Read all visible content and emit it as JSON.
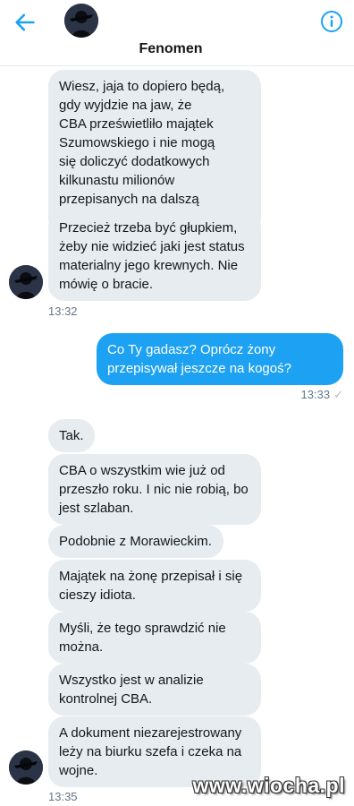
{
  "header": {
    "title": "Fenomen",
    "back_icon": "arrow-left-icon",
    "info_icon": "info-circle-icon"
  },
  "colors": {
    "incoming_bubble": "#e6ecf0",
    "outgoing_bubble": "#1da1f2",
    "accent": "#1da1f2"
  },
  "messages": [
    {
      "from": "them",
      "text": "Wiesz, jaja to dopiero będą,\ngdy wyjdzie na jaw, że\nCBA prześwietliło majątek\nSzumowskiego i nie mogą\nsię doliczyć dodatkowych\nkilkunastu milionów\nprzepisanych na dalszą rodzinę."
    },
    {
      "from": "them",
      "text": "Przecież trzeba być głupkiem,\nżeby nie widzieć jaki jest status\nmaterialny jego krewnych. Nie\nmówię o bracie."
    },
    {
      "from": "me",
      "text": "Co Ty gadasz? Oprócz żony\nprzepisywał jeszcze na kogoś?"
    },
    {
      "from": "them",
      "text": "Tak."
    },
    {
      "from": "them",
      "text": "CBA o wszystkim wie już od\nprzeszło roku. I nic nie robią, bo\njest szlaban."
    },
    {
      "from": "them",
      "text": "Podobnie z Morawieckim."
    },
    {
      "from": "them",
      "text": "Majątek na żonę przepisał i się\ncieszy idiota."
    },
    {
      "from": "them",
      "text": "Myśli, że tego sprawdzić nie\nmożna."
    },
    {
      "from": "them",
      "text": "Wszystko jest w analizie\nkontrolnej CBA."
    },
    {
      "from": "them",
      "text": "A dokument niezarejestrowany\nleży na biurku szefa i czeka na\nwojne."
    }
  ],
  "timestamps": [
    "13:32",
    "13:33",
    "13:35"
  ],
  "watermark": "www.wiocha.pl"
}
